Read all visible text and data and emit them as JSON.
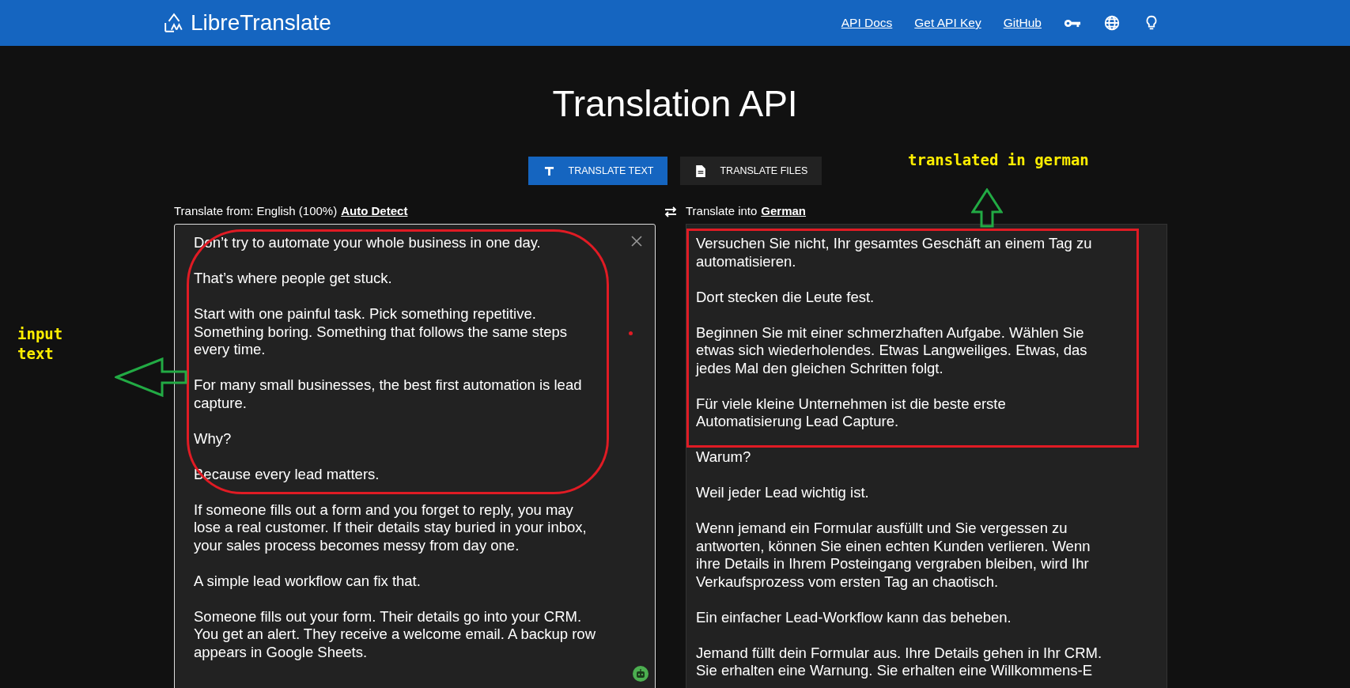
{
  "header": {
    "logo_text": "LibreTranslate",
    "links": [
      "API Docs",
      "Get API Key",
      "GitHub"
    ]
  },
  "title": "Translation API",
  "mode_tabs": [
    {
      "label": "TRANSLATE TEXT",
      "selected": true,
      "kind": "text"
    },
    {
      "label": "TRANSLATE FILES",
      "selected": false,
      "kind": "file"
    }
  ],
  "source": {
    "label": "Translate from: English (100%)",
    "language_link": "Auto Detect",
    "paragraphs": [
      "Don’t try to automate your whole business in one day.",
      "That’s where people get stuck.",
      "Start with one painful task. Pick something repetitive. Something boring. Something that follows the same steps every time.",
      "For many small businesses, the best first automation is lead capture.",
      "Why?",
      "Because every lead matters.",
      "If someone fills out a form and you forget to reply, you may lose a real customer. If their details stay buried in your inbox, your sales process becomes messy from day one.",
      "A simple lead workflow can fix that.",
      "Someone fills out your form. Their details go into your CRM. You get an alert. They receive a welcome email. A backup row appears in Google Sheets."
    ]
  },
  "target": {
    "label": "Translate into",
    "language_link": "German",
    "paragraphs": [
      "Versuchen Sie nicht, Ihr gesamtes Geschäft an einem Tag zu automatisieren.",
      "Dort stecken die Leute fest.",
      "Beginnen Sie mit einer schmerzhaften Aufgabe. Wählen Sie etwas sich wiederholendes. Etwas Langweiliges. Etwas, das jedes Mal den gleichen Schritten folgt.",
      "Für viele kleine Unternehmen ist die beste erste Automatisierung Lead Capture.",
      "Warum?",
      "Weil jeder Lead wichtig ist.",
      "Wenn jemand ein Formular ausfüllt und Sie vergessen zu antworten, können Sie einen echten Kunden verlieren. Wenn ihre Details in Ihrem Posteingang vergraben bleiben, wird Ihr Verkaufsprozess vom ersten Tag an chaotisch.",
      "Ein einfacher Lead-Workflow kann das beheben.",
      "Jemand füllt dein Formular aus. Ihre Details gehen in Ihr CRM. Sie erhalten eine Warnung. Sie erhalten eine Willkommens-E"
    ]
  },
  "annotations": [
    {
      "kind": "note",
      "text": "input text"
    },
    {
      "kind": "note",
      "text": "translated in german"
    }
  ]
}
